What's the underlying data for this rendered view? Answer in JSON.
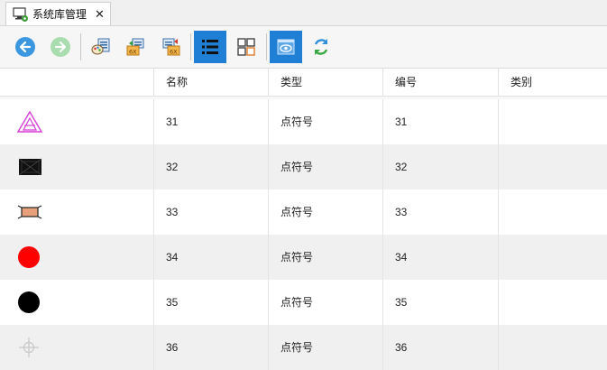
{
  "tab": {
    "title": "系统库管理",
    "close": "✕",
    "icon": "system-library-icon"
  },
  "toolbar": {
    "buttons": [
      {
        "name": "back",
        "icon": "back-arrow-icon",
        "active": false
      },
      {
        "name": "forward",
        "icon": "forward-arrow-icon",
        "active": false
      },
      {
        "name": "symbol-edit",
        "icon": "symbol-palette-icon",
        "active": false
      },
      {
        "name": "export-library",
        "icon": "export-library-icon",
        "active": false
      },
      {
        "name": "import-library",
        "icon": "import-library-icon",
        "active": false
      },
      {
        "name": "list-view",
        "icon": "list-view-icon",
        "active": true
      },
      {
        "name": "grid-view",
        "icon": "grid-view-icon",
        "active": false
      },
      {
        "name": "preview",
        "icon": "preview-eye-icon",
        "active": true
      },
      {
        "name": "refresh",
        "icon": "sync-arrows-icon",
        "active": false
      }
    ],
    "accent_color": "#1e7fd4"
  },
  "table": {
    "columns": [
      "",
      "名称",
      "类型",
      "编号",
      "类别"
    ],
    "rows": [
      {
        "symbol": "triangle-symbol-icon",
        "name": "31",
        "type": "点符号",
        "code": "31",
        "category": ""
      },
      {
        "symbol": "black-rectangle-symbol-icon",
        "name": "32",
        "type": "点符号",
        "code": "32",
        "category": ""
      },
      {
        "symbol": "bowtie-rectangle-symbol-icon",
        "name": "33",
        "type": "点符号",
        "code": "33",
        "category": ""
      },
      {
        "symbol": "red-circle-symbol-icon",
        "name": "34",
        "type": "点符号",
        "code": "34",
        "category": ""
      },
      {
        "symbol": "black-circle-symbol-icon",
        "name": "35",
        "type": "点符号",
        "code": "35",
        "category": ""
      },
      {
        "symbol": "crosshair-symbol-icon",
        "name": "36",
        "type": "点符号",
        "code": "36",
        "category": ""
      }
    ]
  }
}
